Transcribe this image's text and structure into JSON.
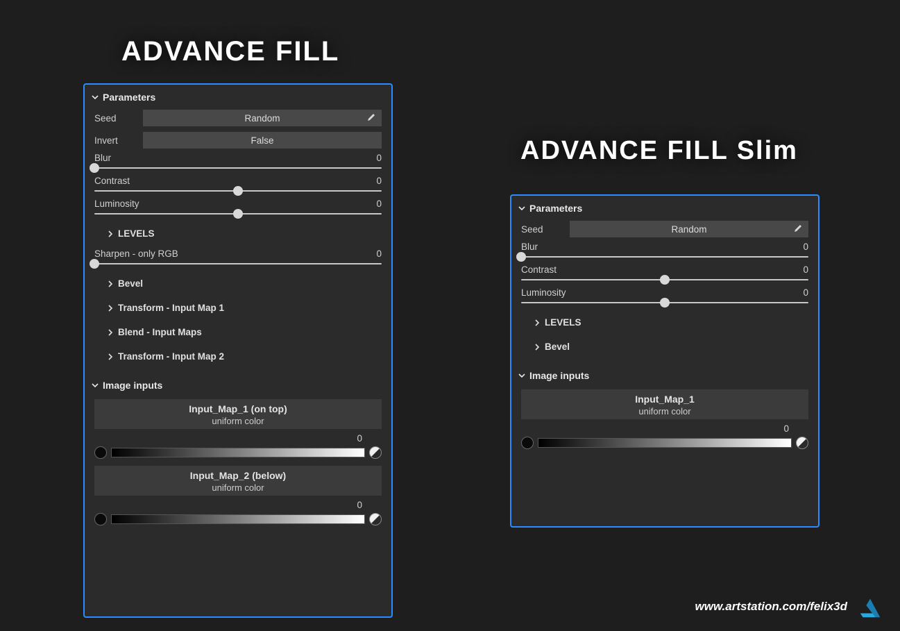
{
  "headings": {
    "left": "ADVANCE FILL",
    "right": "ADVANCE FILL Slim"
  },
  "left_panel": {
    "section_parameters": "Parameters",
    "seed": {
      "label": "Seed",
      "value": "Random"
    },
    "invert": {
      "label": "Invert",
      "value": "False"
    },
    "sliders": {
      "blur": {
        "label": "Blur",
        "value": "0",
        "pos": 0
      },
      "contrast": {
        "label": "Contrast",
        "value": "0",
        "pos": 50
      },
      "luminosity": {
        "label": "Luminosity",
        "value": "0",
        "pos": 50
      },
      "sharpen": {
        "label": "Sharpen - only RGB",
        "value": "0",
        "pos": 0
      }
    },
    "subsections": {
      "levels": "LEVELS",
      "bevel": "Bevel",
      "transform1": "Transform - Input Map 1",
      "blend": "Blend -  Input Maps",
      "transform2": "Transform - Input Map 2"
    },
    "section_image_inputs": "Image inputs",
    "input1": {
      "name": "Input_Map_1 (on top)",
      "sub": "uniform color",
      "value": "0"
    },
    "input2": {
      "name": "Input_Map_2 (below)",
      "sub": "uniform color",
      "value": "0"
    }
  },
  "right_panel": {
    "section_parameters": "Parameters",
    "seed": {
      "label": "Seed",
      "value": "Random"
    },
    "sliders": {
      "blur": {
        "label": "Blur",
        "value": "0",
        "pos": 0
      },
      "contrast": {
        "label": "Contrast",
        "value": "0",
        "pos": 50
      },
      "luminosity": {
        "label": "Luminosity",
        "value": "0",
        "pos": 50
      }
    },
    "subsections": {
      "levels": "LEVELS",
      "bevel": "Bevel"
    },
    "section_image_inputs": "Image inputs",
    "input1": {
      "name": "Input_Map_1",
      "sub": "uniform color",
      "value": "0"
    }
  },
  "footer": {
    "text": "www.artstation.com/felix3d"
  }
}
